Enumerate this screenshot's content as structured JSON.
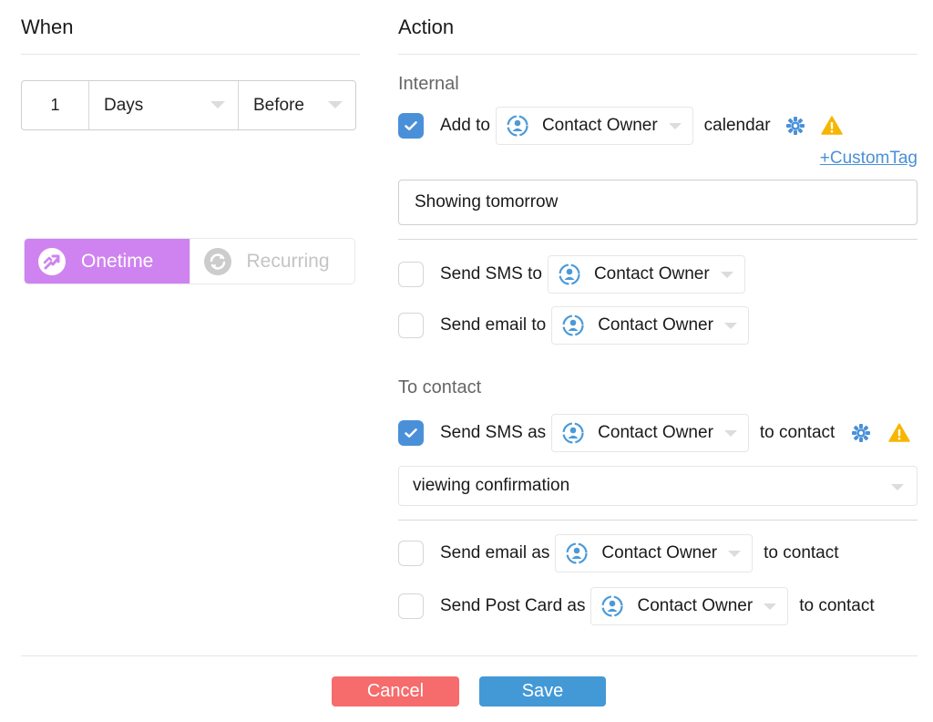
{
  "when": {
    "heading": "When",
    "amount": "1",
    "unit": "Days",
    "relation": "Before",
    "mode_options": [
      {
        "label": "Onetime",
        "icon": "onetime-icon",
        "active": true
      },
      {
        "label": "Recurring",
        "icon": "recurring-icon",
        "active": false
      }
    ]
  },
  "action": {
    "heading": "Action",
    "internal": {
      "label": "Internal",
      "calendar": {
        "checked": true,
        "prefix": "Add to",
        "recipient": "Contact Owner",
        "suffix": "calendar",
        "custom_tag_link": "+CustomTag",
        "title_value": "Showing tomorrow"
      },
      "sms": {
        "checked": false,
        "prefix": "Send SMS to",
        "recipient": "Contact Owner"
      },
      "email": {
        "checked": false,
        "prefix": "Send email to",
        "recipient": "Contact Owner"
      }
    },
    "to_contact": {
      "label": "To contact",
      "sms": {
        "checked": true,
        "prefix": "Send SMS as",
        "sender": "Contact Owner",
        "suffix": "to contact",
        "template": "viewing confirmation"
      },
      "email": {
        "checked": false,
        "prefix": "Send email as",
        "sender": "Contact Owner",
        "suffix": "to contact"
      },
      "postcard": {
        "checked": false,
        "prefix": "Send Post Card as",
        "sender": "Contact Owner",
        "suffix": "to contact"
      }
    }
  },
  "footer": {
    "cancel_label": "Cancel",
    "save_label": "Save"
  },
  "colors": {
    "accent_blue": "#4a90d9",
    "onetime_purple": "#cf83f0",
    "cancel_red": "#f66b6b",
    "save_blue": "#4399d6",
    "warning_yellow": "#f7b500"
  }
}
